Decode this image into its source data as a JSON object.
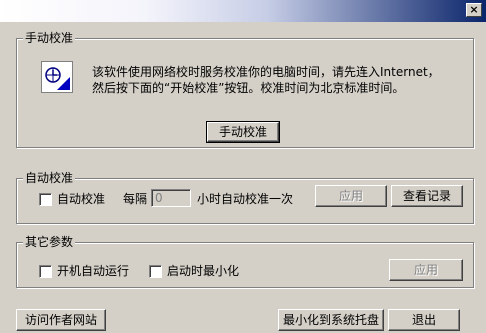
{
  "window": {
    "title": "",
    "close_glyph": "×"
  },
  "manual": {
    "title": "手动校准",
    "desc_line1": "该软件使用网络校时服务校准你的电脑时间，请先连入Internet，",
    "desc_line2": "然后按下面的“开始校准”按钮。校准时间为北京标准时间。",
    "button_label": "手动校准",
    "icon": "clock-sync-icon"
  },
  "auto": {
    "title": "自动校准",
    "checkbox_label": "自动校准",
    "checked": false,
    "interval_prefix": "每隔",
    "interval_value": "0",
    "interval_suffix": "小时自动校准一次",
    "apply_label": "应用",
    "view_log_label": "查看记录"
  },
  "other": {
    "title": "其它参数",
    "startup_label": "开机自动运行",
    "startup_checked": false,
    "minimize_label": "启动时最小化",
    "minimize_checked": false,
    "apply_label": "应用"
  },
  "footer": {
    "visit_site_label": "访问作者网站",
    "minimize_tray_label": "最小化到系统托盘",
    "exit_label": "退出"
  }
}
